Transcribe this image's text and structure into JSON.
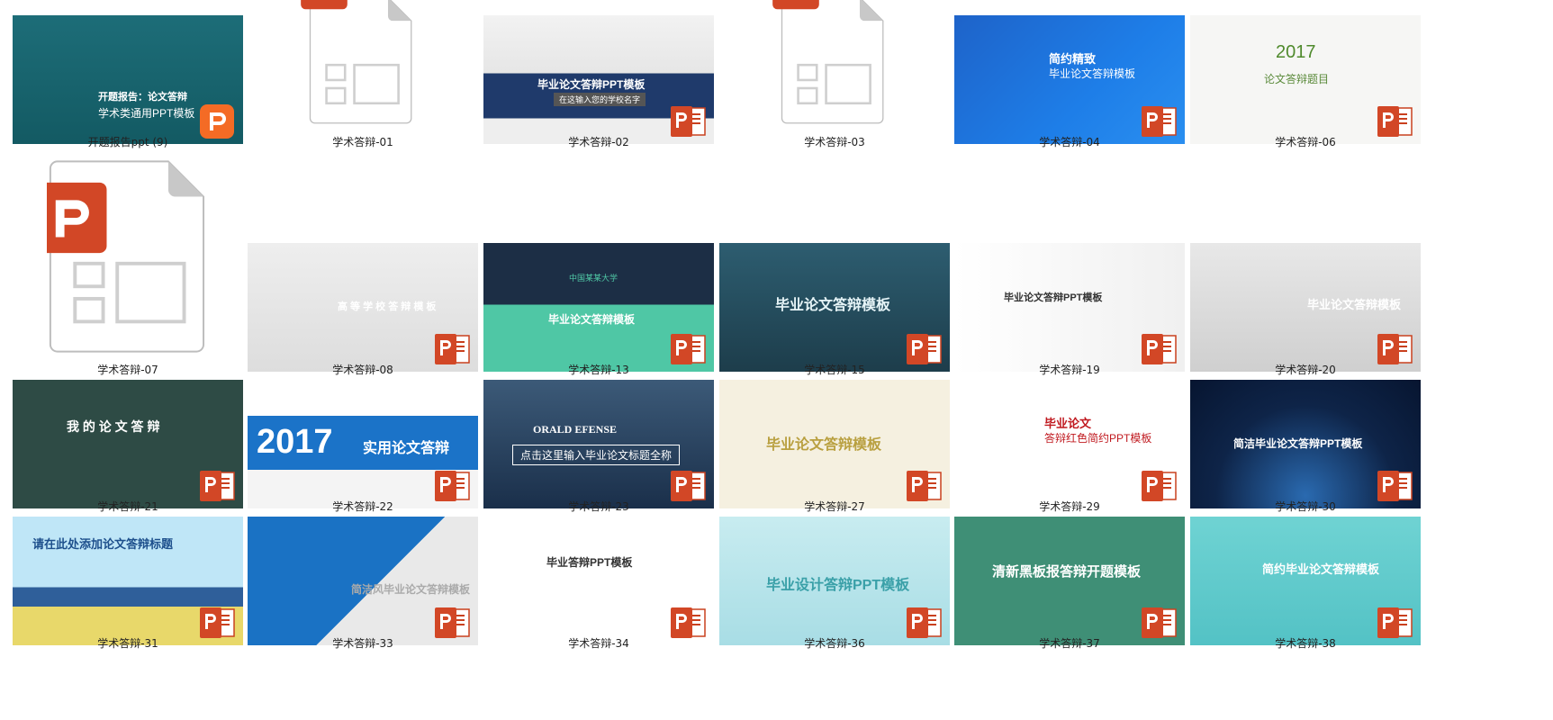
{
  "files": [
    {
      "name": "开题报告ppt (9)",
      "kind": "thumb",
      "style": "books",
      "title": "开题报告：论文答辩",
      "subtitle": "学术类通用PPT模板",
      "badge": "orange"
    },
    {
      "name": "学术答辩-01",
      "kind": "doc-partial"
    },
    {
      "name": "学术答辩-02",
      "kind": "thumb",
      "style": "navy-seal",
      "title": "毕业论文答辩PPT模板",
      "subtitle": "在这输入您的学校名字",
      "badge": "red"
    },
    {
      "name": "学术答辩-03",
      "kind": "doc-partial"
    },
    {
      "name": "学术答辩-04",
      "kind": "thumb",
      "style": "blue-cap",
      "title": "简约精致",
      "subtitle": "毕业论文答辩模板",
      "badge": "red"
    },
    {
      "name": "学术答辩-06",
      "kind": "thumb",
      "style": "green-2017",
      "year": "2017",
      "title": "论文答辩题目",
      "badge": "red"
    },
    {
      "name": "学术答辩-07",
      "kind": "doc-full"
    },
    {
      "name": "学术答辩-08",
      "kind": "thumb",
      "style": "grey-book",
      "title": "高 等 学 校 答 辩 模 板",
      "badge": "red"
    },
    {
      "name": "学术答辩-13",
      "kind": "thumb",
      "style": "teal-navy",
      "title": "毕业论文答辩模板",
      "subtitle": "中国某某大学",
      "badge": "red"
    },
    {
      "name": "学术答辩-15",
      "kind": "thumb",
      "style": "dark-teal",
      "title": "毕业论文答辩模板",
      "badge": "red"
    },
    {
      "name": "学术答辩-19",
      "kind": "thumb",
      "style": "white-cap",
      "title": "毕业论文答辩PPT模板",
      "badge": "red"
    },
    {
      "name": "学术答辩-20",
      "kind": "thumb",
      "style": "grey-stack",
      "title": "毕业论文答辩模板",
      "badge": "red"
    },
    {
      "name": "学术答辩-21",
      "kind": "thumb",
      "style": "chalk",
      "title": "我 的 论 文 答 辩",
      "badge": "red"
    },
    {
      "name": "学术答辩-22",
      "kind": "thumb",
      "style": "blue-2017",
      "year": "2017",
      "title": "实用论文答辩",
      "badge": "red"
    },
    {
      "name": "学术答辩-23",
      "kind": "thumb",
      "style": "gate",
      "title": "ORALD EFENSE",
      "subtitle": "点击这里输入毕业论文标题全称",
      "badge": "red"
    },
    {
      "name": "学术答辩-27",
      "kind": "thumb",
      "style": "floral",
      "title": "毕业论文答辩模板",
      "badge": "red"
    },
    {
      "name": "学术答辩-29",
      "kind": "thumb",
      "style": "red-white",
      "title": "毕业论文",
      "subtitle": "答辩红色简约PPT模板",
      "badge": "red"
    },
    {
      "name": "学术答辩-30",
      "kind": "thumb",
      "style": "space",
      "title": "简洁毕业论文答辩PPT模板",
      "badge": "red"
    },
    {
      "name": "学术答辩-31",
      "kind": "thumb",
      "style": "yellow-cap",
      "title": "请在此处添加论文答辩标题",
      "badge": "red"
    },
    {
      "name": "学术答辩-33",
      "kind": "thumb",
      "style": "pku",
      "title": "简洁风毕业论文答辩模板",
      "badge": "red"
    },
    {
      "name": "学术答辩-34",
      "kind": "thumb",
      "style": "leaves",
      "title": "毕业答辩PPT模板",
      "badge": "red"
    },
    {
      "name": "学术答辩-36",
      "kind": "thumb",
      "style": "light-blue",
      "title": "毕业设计答辩PPT模板",
      "badge": "red"
    },
    {
      "name": "学术答辩-37",
      "kind": "thumb",
      "style": "green-board",
      "title": "清新黑板报答辩开题模板",
      "badge": "red"
    },
    {
      "name": "学术答辩-38",
      "kind": "thumb",
      "style": "cyan-blocks",
      "title": "简约毕业论文答辩模板",
      "badge": "red"
    }
  ]
}
